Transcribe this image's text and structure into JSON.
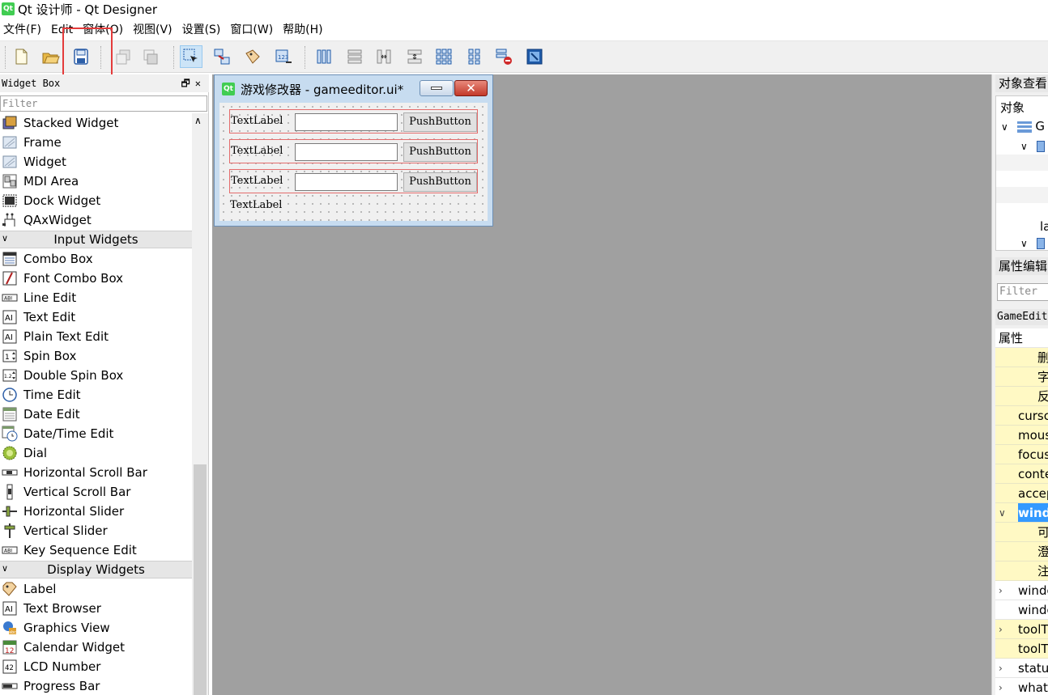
{
  "window": {
    "title": "Qt 设计师 - Qt Designer",
    "app_icon": "Qt"
  },
  "menubar": [
    "文件(F)",
    "Edit",
    "窗体(O)",
    "视图(V)",
    "设置(S)",
    "窗口(W)",
    "帮助(H)"
  ],
  "widget_box": {
    "title": "Widget Box",
    "header_buttons": "🗗✕",
    "filter_placeholder": "Filter",
    "items_top": [
      {
        "label": "Stacked Widget",
        "icon": "stacked-widget-icon"
      },
      {
        "label": "Frame",
        "icon": "frame-icon"
      },
      {
        "label": "Widget",
        "icon": "widget-icon"
      },
      {
        "label": "MDI Area",
        "icon": "mdi-area-icon"
      },
      {
        "label": "Dock Widget",
        "icon": "dock-widget-icon"
      },
      {
        "label": "QAxWidget",
        "icon": "qaxwidget-icon"
      }
    ],
    "category_input": "Input Widgets",
    "items_input": [
      {
        "label": "Combo Box",
        "icon": "combo-box-icon"
      },
      {
        "label": "Font Combo Box",
        "icon": "font-combo-box-icon"
      },
      {
        "label": "Line Edit",
        "icon": "line-edit-icon"
      },
      {
        "label": "Text Edit",
        "icon": "text-edit-icon"
      },
      {
        "label": "Plain Text Edit",
        "icon": "plain-text-edit-icon"
      },
      {
        "label": "Spin Box",
        "icon": "spin-box-icon"
      },
      {
        "label": "Double Spin Box",
        "icon": "double-spin-box-icon"
      },
      {
        "label": "Time Edit",
        "icon": "time-edit-icon"
      },
      {
        "label": "Date Edit",
        "icon": "date-edit-icon"
      },
      {
        "label": "Date/Time Edit",
        "icon": "datetime-edit-icon"
      },
      {
        "label": "Dial",
        "icon": "dial-icon"
      },
      {
        "label": "Horizontal Scroll Bar",
        "icon": "horizontal-scroll-bar-icon"
      },
      {
        "label": "Vertical Scroll Bar",
        "icon": "vertical-scroll-bar-icon"
      },
      {
        "label": "Horizontal Slider",
        "icon": "horizontal-slider-icon"
      },
      {
        "label": "Vertical Slider",
        "icon": "vertical-slider-icon"
      },
      {
        "label": "Key Sequence Edit",
        "icon": "key-sequence-edit-icon"
      }
    ],
    "category_display": "Display Widgets",
    "items_display": [
      {
        "label": "Label",
        "icon": "label-icon"
      },
      {
        "label": "Text Browser",
        "icon": "text-browser-icon"
      },
      {
        "label": "Graphics View",
        "icon": "graphics-view-icon"
      },
      {
        "label": "Calendar Widget",
        "icon": "calendar-widget-icon"
      },
      {
        "label": "LCD Number",
        "icon": "lcd-number-icon"
      },
      {
        "label": "Progress Bar",
        "icon": "progress-bar-icon"
      }
    ]
  },
  "form": {
    "title": "游戏修改器 - gameeditor.ui*",
    "rows": [
      {
        "label": "TextLabel",
        "button": "PushButton"
      },
      {
        "label": "TextLabel",
        "button": "PushButton"
      },
      {
        "label": "TextLabel",
        "button": "PushButton"
      }
    ],
    "bottom_label": "TextLabel",
    "close_glyph": "✕"
  },
  "object_inspector": {
    "title": "对象查看",
    "column": "对象",
    "rows": [
      "G",
      "la"
    ]
  },
  "property_editor": {
    "title": "属性编辑",
    "filter_placeholder": "Filter",
    "class_label": "GameEdit",
    "column": "属性",
    "rows": [
      {
        "text": "删",
        "indent": 2,
        "style": "yellow"
      },
      {
        "text": "字",
        "indent": 2,
        "style": "yellow"
      },
      {
        "text": "反",
        "indent": 2,
        "style": "yellow"
      },
      {
        "text": "cursc",
        "indent": 1,
        "style": "yellow"
      },
      {
        "text": "mous",
        "indent": 1,
        "style": "yellow"
      },
      {
        "text": "focus",
        "indent": 1,
        "style": "yellow"
      },
      {
        "text": "conte",
        "indent": 1,
        "style": "yellow"
      },
      {
        "text": "accep",
        "indent": 1,
        "style": "yellow"
      },
      {
        "text": "wind",
        "indent": 1,
        "style": "selected",
        "expanded": true
      },
      {
        "text": "可",
        "indent": 2,
        "style": "yellow"
      },
      {
        "text": "澄",
        "indent": 2,
        "style": "yellow"
      },
      {
        "text": "注",
        "indent": 2,
        "style": "yellow"
      },
      {
        "text": "windo",
        "indent": 1,
        "style": "white",
        "collapsed": true
      },
      {
        "text": "windo",
        "indent": 1,
        "style": "white"
      },
      {
        "text": "toolT",
        "indent": 1,
        "style": "yellow",
        "collapsed": true
      },
      {
        "text": "toolT",
        "indent": 1,
        "style": "yellow"
      },
      {
        "text": "statu",
        "indent": 1,
        "style": "white",
        "collapsed": true
      },
      {
        "text": "whats",
        "indent": 1,
        "style": "white",
        "collapsed": true
      }
    ]
  },
  "colors": {
    "highlight_box": "#e43b3b",
    "selection": "#3399ff",
    "property_yellow": "#fff9c4"
  }
}
